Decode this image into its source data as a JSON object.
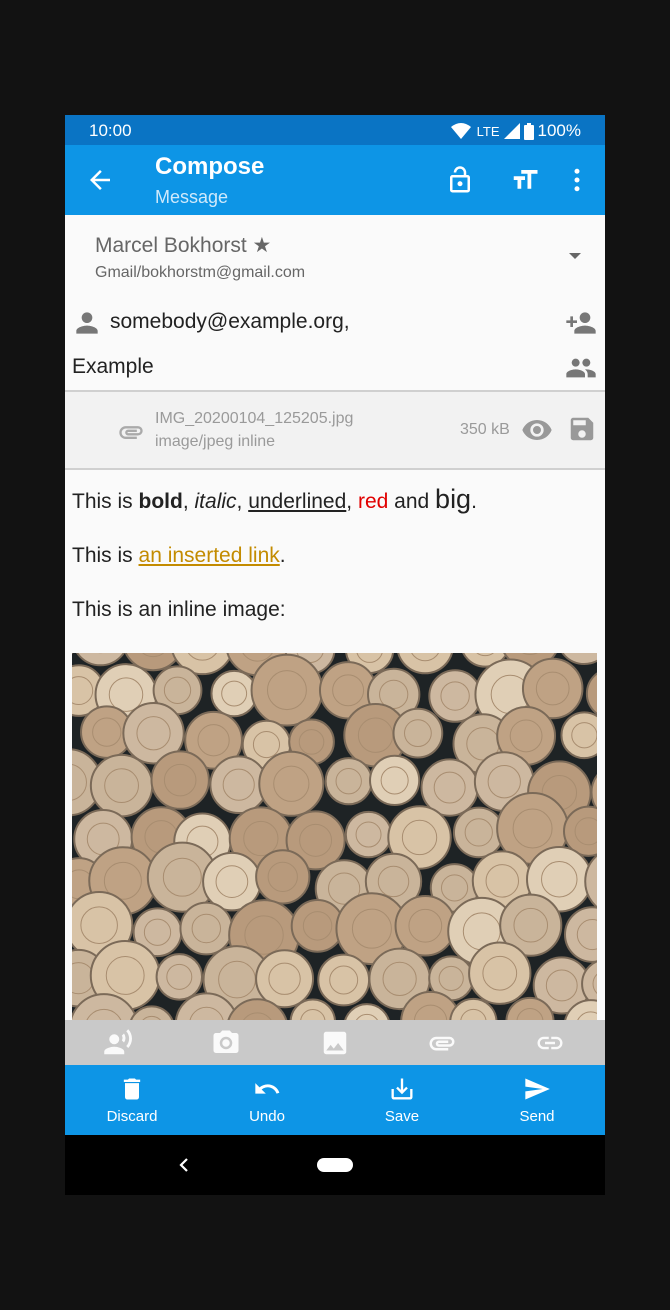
{
  "status": {
    "time": "10:00",
    "network": "LTE",
    "battery": "100%"
  },
  "appbar": {
    "title": "Compose",
    "subtitle": "Message"
  },
  "from": {
    "name": "Marcel Bokhorst ★",
    "account": "Gmail/bokhorstm@gmail.com"
  },
  "to": {
    "value": "somebody@example.org,"
  },
  "subject": {
    "value": "Example"
  },
  "attachment": {
    "filename": "IMG_20200104_125205.jpg",
    "type": "image/jpeg inline",
    "size": "350 kB"
  },
  "body": {
    "line1": {
      "prefix": "This is ",
      "bold": "bold",
      "sep1": ", ",
      "italic": "italic",
      "sep2": ", ",
      "underlined": "underlined",
      "sep3": ", ",
      "red": "red",
      "and": " and ",
      "big": "big",
      "end": "."
    },
    "line2": {
      "prefix": "This is ",
      "link": "an inserted link",
      "end": "."
    },
    "line3": "This is an inline image:"
  },
  "actions": {
    "discard": "Discard",
    "undo": "Undo",
    "save": "Save",
    "send": "Send"
  },
  "colors": {
    "primary": "#0d95e6",
    "status_bar": "#0a74c4",
    "link": "#c38b00",
    "red_text": "#e10000"
  }
}
